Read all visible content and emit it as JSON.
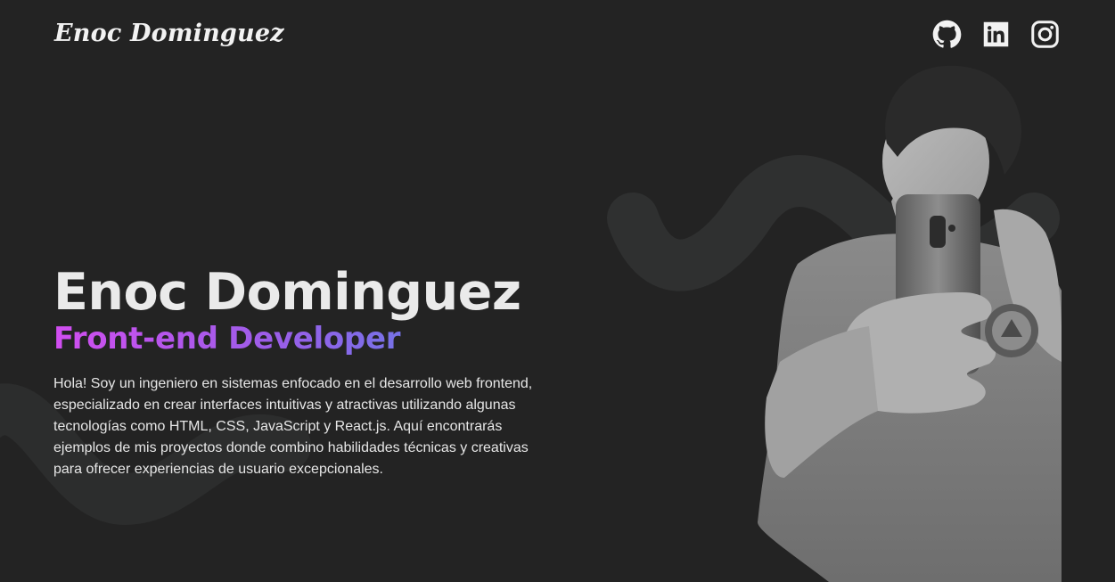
{
  "header": {
    "logo_text": "Enoc Dominguez",
    "social": [
      {
        "icon": "github-icon",
        "label": "GitHub"
      },
      {
        "icon": "linkedin-icon",
        "label": "LinkedIn"
      },
      {
        "icon": "instagram-icon",
        "label": "Instagram"
      }
    ]
  },
  "hero": {
    "name": "Enoc Dominguez",
    "role": "Front-end Developer",
    "bio": "Hola! Soy un ingeniero en sistemas enfocado en el desarrollo web frontend, especializado en crear interfaces intuitivas y atractivas utilizando algunas tecnologías como HTML, CSS, JavaScript y React.js. Aquí encontrarás ejemplos de mis proyectos donde combino habilidades técnicas y creativas para ofrecer experiencias de usuario excepcionales."
  },
  "colors": {
    "background": "#232323",
    "text": "#eaeaea",
    "gradient_start": "#d14ef0",
    "gradient_end": "#4a8ae6",
    "wave": "#2e2f2f"
  }
}
